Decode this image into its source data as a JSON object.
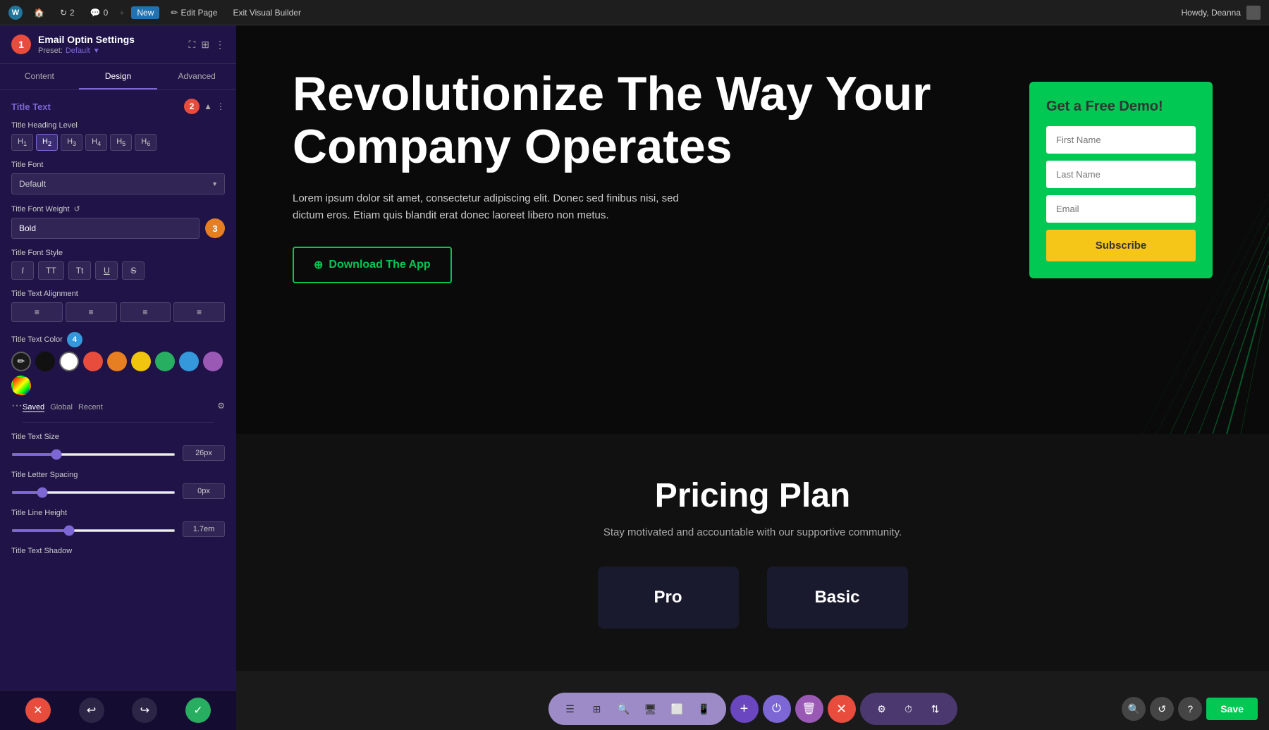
{
  "topbar": {
    "site_url": "example.com",
    "update_count": "2",
    "comment_count": "0",
    "new_label": "New",
    "edit_page_label": "Edit Page",
    "exit_builder_label": "Exit Visual Builder",
    "howdy_label": "Howdy, Deanna"
  },
  "sidebar": {
    "title": "Email Optin Settings",
    "preset_label": "Preset:",
    "preset_value": "Default",
    "tabs": [
      {
        "id": "content",
        "label": "Content"
      },
      {
        "id": "design",
        "label": "Design"
      },
      {
        "id": "advanced",
        "label": "Advanced"
      }
    ],
    "active_tab": "design",
    "section": {
      "title": "Title Text",
      "badge_number": "2"
    },
    "fields": {
      "heading_level": {
        "label": "Title Heading Level",
        "options": [
          "H1",
          "H2",
          "H3",
          "H4",
          "H5",
          "H6"
        ],
        "active": "H2"
      },
      "font": {
        "label": "Title Font",
        "value": "Default"
      },
      "font_weight": {
        "label": "Title Font Weight",
        "value": "Bold",
        "badge_number": "3"
      },
      "font_style": {
        "label": "Title Font Style",
        "options": [
          "I",
          "TT",
          "Tt",
          "U",
          "S"
        ]
      },
      "text_alignment": {
        "label": "Title Text Alignment"
      },
      "text_color": {
        "label": "Title Text Color",
        "badge_number": "4",
        "swatches": [
          {
            "name": "eyedropper",
            "type": "eyedropper"
          },
          {
            "name": "black-1",
            "color": "#111111"
          },
          {
            "name": "white",
            "color": "#ffffff"
          },
          {
            "name": "red",
            "color": "#e74c3c"
          },
          {
            "name": "orange",
            "color": "#e67e22"
          },
          {
            "name": "yellow",
            "color": "#f1c40f"
          },
          {
            "name": "green",
            "color": "#27ae60"
          },
          {
            "name": "blue",
            "color": "#3498db"
          },
          {
            "name": "purple",
            "color": "#9b59b6"
          },
          {
            "name": "custom",
            "type": "custom"
          }
        ],
        "color_tabs": [
          "Saved",
          "Global",
          "Recent"
        ],
        "active_color_tab": "Saved"
      },
      "text_size": {
        "label": "Title Text Size",
        "value": "26px",
        "min": 0,
        "max": 100,
        "current": 26
      },
      "letter_spacing": {
        "label": "Title Letter Spacing",
        "value": "0px",
        "min": -10,
        "max": 50,
        "current": 0
      },
      "line_height": {
        "label": "Title Line Height",
        "value": "1.7em",
        "min": 0,
        "max": 5,
        "current": 34
      },
      "text_shadow": {
        "label": "Title Text Shadow"
      }
    },
    "bottom_btns": {
      "close": "✕",
      "undo": "↩",
      "redo": "↪",
      "confirm": "✓"
    }
  },
  "canvas": {
    "hero": {
      "title": "Revolutionize The Way Your Company Operates",
      "description": "Lorem ipsum dolor sit amet, consectetur adipiscing elit. Donec sed finibus nisi, sed dictum eros. Etiam quis blandit erat donec laoreet libero non metus.",
      "cta_label": "Download The App"
    },
    "form": {
      "title": "Get a Free Demo!",
      "fields": [
        {
          "placeholder": "First Name"
        },
        {
          "placeholder": "Last Name"
        },
        {
          "placeholder": "Email"
        }
      ],
      "submit_label": "Subscribe"
    },
    "pricing": {
      "title": "Pricing Plan",
      "subtitle": "Stay motivated and accountable with our supportive community.",
      "cards": [
        {
          "label": "Pro"
        },
        {
          "label": "Basic"
        }
      ]
    }
  },
  "bottom_toolbar": {
    "add_icon": "+",
    "power_icon": "⏻",
    "trash_icon": "🗑",
    "close_icon": "✕",
    "settings_icon": "⚙",
    "history_icon": "⏱",
    "layout_icon": "⇅",
    "search_icon": "🔍",
    "responsive_icon": "↺",
    "help_icon": "?",
    "save_label": "Save"
  }
}
